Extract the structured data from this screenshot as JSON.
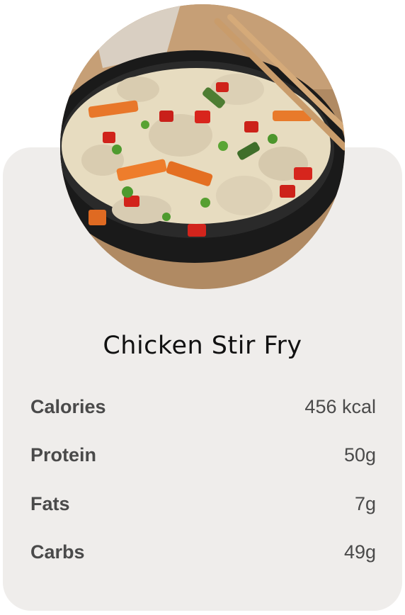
{
  "recipe": {
    "title": "Chicken Stir Fry",
    "image_subject": "chicken-stir-fry-photo"
  },
  "nutrition": [
    {
      "label": "Calories",
      "value": "456 kcal"
    },
    {
      "label": "Protein",
      "value": "50g"
    },
    {
      "label": "Fats",
      "value": "7g"
    },
    {
      "label": "Carbs",
      "value": "49g"
    }
  ],
  "colors": {
    "card_background": "#efedeb",
    "title_text": "#111111",
    "row_text": "#4a4a4a"
  }
}
